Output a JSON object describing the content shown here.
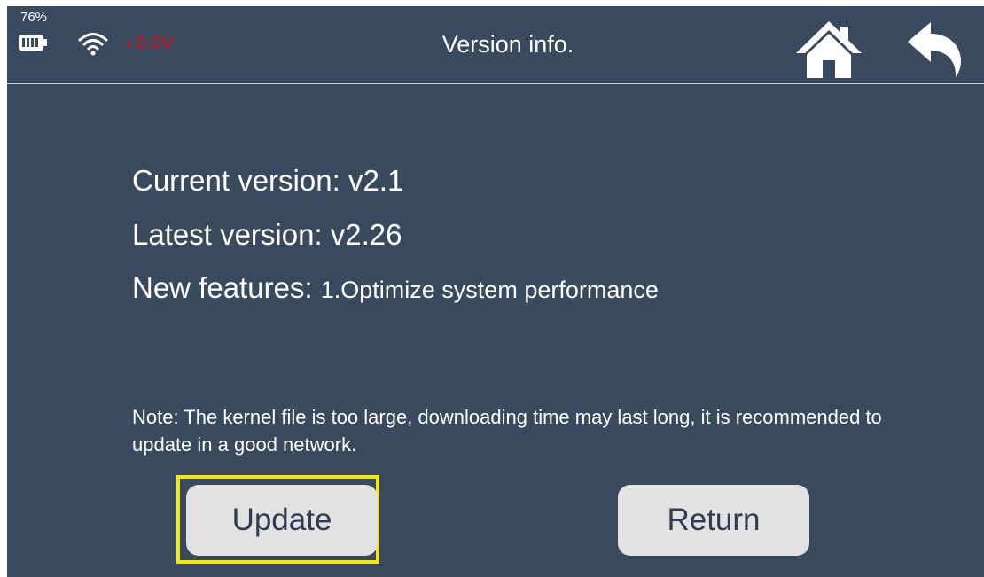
{
  "status_bar": {
    "battery_percent": "76%",
    "voltage": "0.0V",
    "voltage_color": "#d0101c"
  },
  "header": {
    "title": "Version info.",
    "home_icon": "home-icon",
    "back_icon": "back-arrow-icon"
  },
  "info": {
    "current_label": "Current version: ",
    "current_value": "v2.1",
    "latest_label": "Latest version: ",
    "latest_value": "v2.26",
    "features_label": "New features: ",
    "features_value": "1.Optimize system performance"
  },
  "note": "Note: The kernel file is too large, downloading time may last long, it is recommended to update in a good network.",
  "buttons": {
    "update_label": "Update",
    "return_label": "Return"
  },
  "colors": {
    "background": "#3a4a5e",
    "button": "#e2e2e2",
    "button_text": "#2f3d52",
    "highlight": "#f2ea10"
  }
}
